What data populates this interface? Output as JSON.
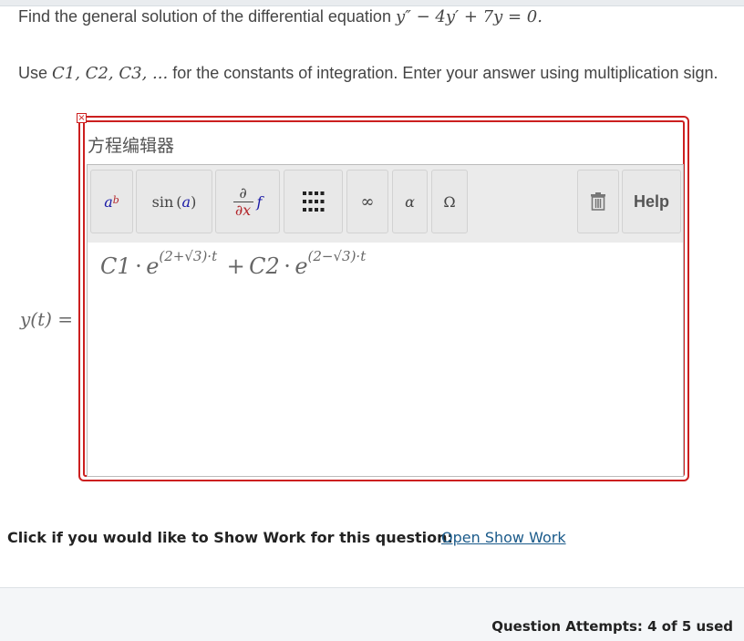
{
  "question": {
    "prefix": "Find the general solution of the differential equation ",
    "equation": "y″ − 4y′ + 7y = 0."
  },
  "instructions": {
    "part1": "Use ",
    "constants": "C1, C2, C3, ...",
    "part2": " for the constants of integration. Enter your answer using multiplication sign."
  },
  "answer_label": "y(t) =",
  "editor": {
    "title": "方程编辑器",
    "close_label": "×",
    "toolbar": {
      "power_base": "a",
      "power_exp": "b",
      "sin_label": "sin",
      "sin_arg": "a",
      "deriv_num": "∂",
      "deriv_den": "∂x",
      "deriv_f": "f",
      "infinity": "∞",
      "alpha": "α",
      "omega": "Ω",
      "help": "Help"
    },
    "answer": {
      "c1": "C1",
      "dot1": "·",
      "e1": "e",
      "exp1": "(2+√3)·t",
      "plus": "+",
      "c2": "C2",
      "dot2": "·",
      "e2": "e",
      "exp2": "(2−√3)·t"
    }
  },
  "show_work": {
    "prompt": "Click if you would like to Show Work for this question:",
    "link": "Open Show Work"
  },
  "attempts": "Question Attempts: 4 of 5 used",
  "colors": {
    "editor_border": "#cc1f1f",
    "link": "#1a5a8a",
    "toolbar_bg": "#ebebeb"
  }
}
